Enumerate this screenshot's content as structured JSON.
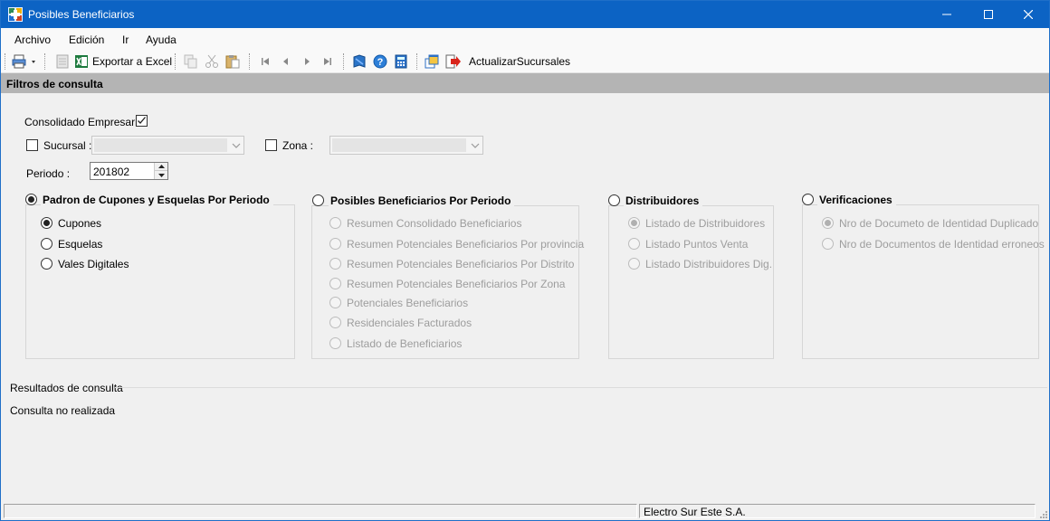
{
  "window": {
    "title": "Posibles Beneficiarios"
  },
  "menu": {
    "items": [
      "Archivo",
      "Edición",
      "Ir",
      "Ayuda"
    ]
  },
  "toolbar": {
    "export_label": "Exportar a Excel",
    "update_label": "ActualizarSucursales"
  },
  "filters": {
    "header": "Filtros de consulta",
    "consolidado_label": "Consolidado Empresarial",
    "consolidado_checked": true,
    "sucursal_label": "Sucursal :",
    "sucursal_checked": false,
    "sucursal_value": "",
    "zona_label": "Zona :",
    "zona_checked": false,
    "zona_value": "",
    "periodo_label": "Periodo :",
    "periodo_value": "201802"
  },
  "groups": {
    "padron": {
      "title": "Padron de Cupones y Esquelas Por Periodo",
      "selected": true,
      "options": [
        "Cupones",
        "Esquelas",
        "Vales Digitales"
      ]
    },
    "posibles": {
      "title": "Posibles Beneficiarios Por Periodo",
      "selected": false,
      "options": [
        "Resumen Consolidado Beneficiarios",
        "Resumen Potenciales Beneficiarios Por provincia",
        "Resumen Potenciales Beneficiarios Por Distrito",
        "Resumen Potenciales Beneficiarios Por Zona",
        "Potenciales Beneficiarios",
        "Residenciales Facturados",
        "Listado de Beneficiarios"
      ]
    },
    "distribuidores": {
      "title": "Distribuidores",
      "selected": false,
      "options": [
        "Listado de Distribuidores",
        "Listado Puntos Venta",
        "Listado Distribuidores Dig."
      ]
    },
    "verificaciones": {
      "title": "Verificaciones",
      "selected": false,
      "options": [
        "Nro de Documeto de Identidad Duplicado",
        "Nro de Documentos de Identidad erroneos"
      ]
    }
  },
  "results": {
    "header": "Resultados de consulta",
    "status": "Consulta no realizada"
  },
  "statusbar": {
    "company": "Electro Sur Este S.A."
  },
  "colors": {
    "titlebar": "#0c63c4",
    "section_header": "#b4b4b4",
    "window_bg": "#f0f0f0"
  }
}
